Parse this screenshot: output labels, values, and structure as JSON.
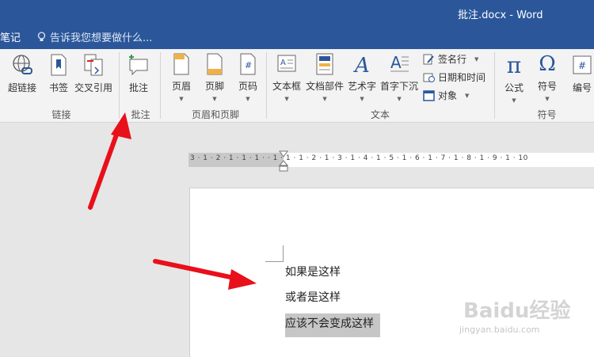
{
  "titlebar": {
    "title": "批注.docx - Word",
    "left_menu": "笔记",
    "tell_me": "告诉我您想要做什么..."
  },
  "ribbon": {
    "links": {
      "label": "链接",
      "buttons": [
        "超链接",
        "书签",
        "交叉引用"
      ]
    },
    "comments": {
      "label": "批注",
      "buttons": [
        "批注"
      ]
    },
    "header_footer": {
      "label": "页眉和页脚",
      "buttons": [
        "页眉",
        "页脚",
        "页码"
      ]
    },
    "text": {
      "label": "文本",
      "buttons": [
        "文本框",
        "文档部件",
        "艺术字",
        "首字下沉"
      ],
      "small": [
        "签名行",
        "日期和时间",
        "对象"
      ]
    },
    "symbols": {
      "label": "符号",
      "buttons": [
        "公式",
        "符号",
        "编号"
      ]
    }
  },
  "ruler": {
    "text": "3 · 1 · 2 · 1 · 1 · 1 ·  · 1 · 1 · 1 · 2 · 1 · 3 · 1 · 4 · 1 · 5 · 1 · 6 · 1 · 7 · 1 · 8 · 1 · 9 · 1 · 10"
  },
  "document": {
    "lines": [
      "如果是这样",
      "或者是这样",
      "应该不会变成这样"
    ]
  },
  "watermark": {
    "brand": "Baidu经验",
    "url": "jingyan.baidu.com"
  },
  "colors": {
    "accent": "#2b579a",
    "arrow": "#e8101a"
  }
}
